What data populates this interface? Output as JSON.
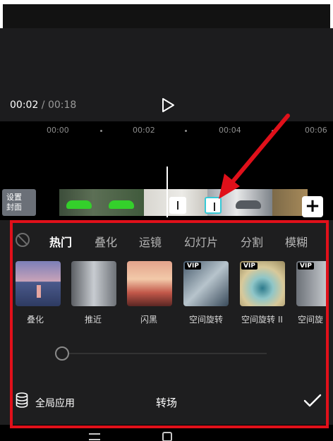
{
  "player": {
    "current_time": "00:02",
    "separator": " / ",
    "total_time": "00:18"
  },
  "ruler": {
    "ticks": [
      "00:00",
      "00:02",
      "00:04",
      "00:06"
    ]
  },
  "track": {
    "cover_label_line1": "设置",
    "cover_label_line2": "封面"
  },
  "transition_panel": {
    "tabs": [
      "热门",
      "叠化",
      "运镜",
      "幻灯片",
      "分割",
      "模糊"
    ],
    "active_tab": "热门",
    "effects": [
      {
        "label": "叠化",
        "vip": false
      },
      {
        "label": "推近",
        "vip": false
      },
      {
        "label": "闪黑",
        "vip": false
      },
      {
        "label": "空间旋转",
        "vip": true
      },
      {
        "label": "空间旋转 II",
        "vip": true
      },
      {
        "label": "空间旋",
        "vip": true
      }
    ],
    "vip_badge": "VIP",
    "apply_all_label": "全局应用",
    "title": "转场"
  },
  "colors": {
    "highlight_frame": "#e0101a",
    "arrow": "#e0101a",
    "active_transition": "#36c9d6"
  }
}
